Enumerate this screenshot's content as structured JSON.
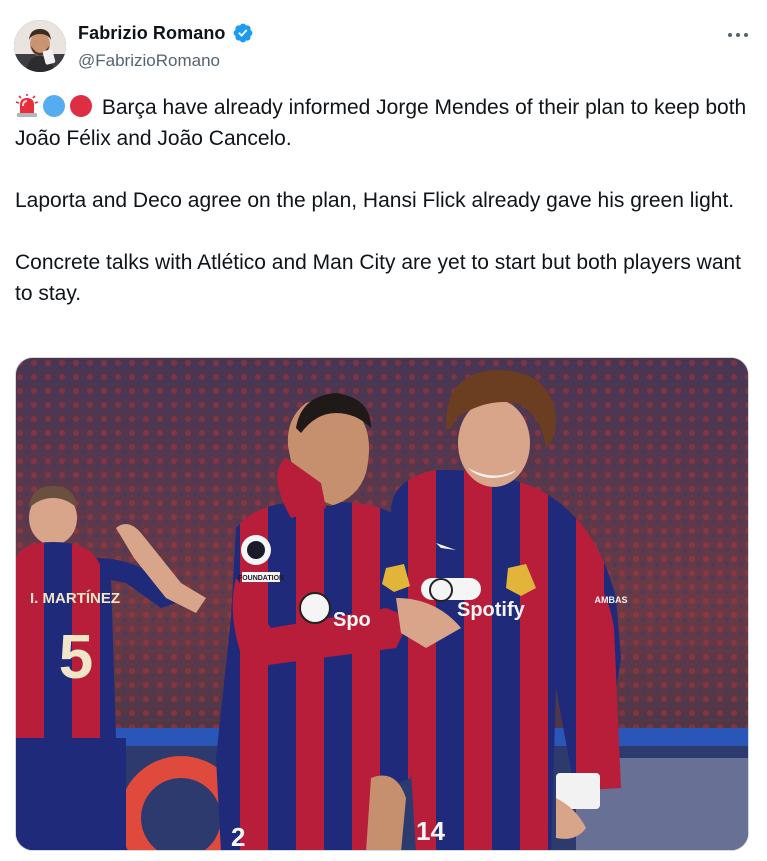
{
  "author": {
    "display_name": "Fabrizio Romano",
    "handle": "@FabrizioRomano",
    "verified": true,
    "verified_color": "#1d9bf0",
    "avatar_icon": "avatar-photo"
  },
  "menu": {
    "more_icon": "more-horizontal-icon"
  },
  "tweet": {
    "emojis": [
      "police-light-emoji",
      "blue-circle-emoji",
      "red-circle-emoji"
    ],
    "paragraph_1": "Barça have already informed Jorge Mendes of their plan to keep both João Félix and João Cancelo.",
    "paragraph_2": "Laporta and Deco agree on the plan, Hansi Flick already gave his green light.",
    "paragraph_3": "Concrete talks with Atlético and Man City are yet to start but both players want to stay."
  },
  "media": {
    "type": "photo",
    "shirt_sponsor_left": "Spo",
    "shirt_sponsor_right": "Spotify",
    "back_player_name": "I. MARTÍNEZ",
    "back_player_number": "5",
    "front_number_left": "2",
    "front_number_right": "14",
    "sleeve_badge": "FOUNDATION",
    "armband_text": "AMBAS"
  }
}
